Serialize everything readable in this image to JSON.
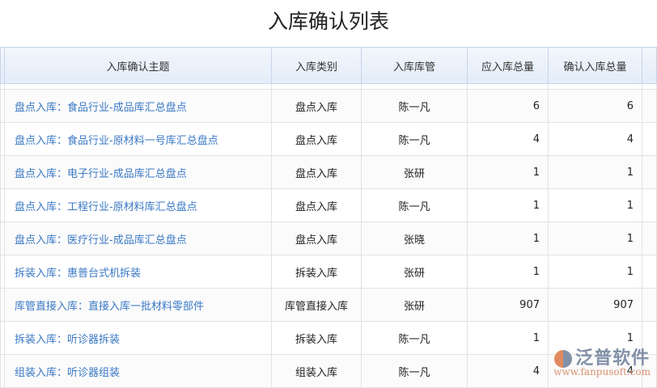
{
  "title": "入库确认列表",
  "headers": [
    "入库确认主题",
    "入库类别",
    "入库库管",
    "应入库总量",
    "确认入库总量"
  ],
  "rows": [
    [
      "盘点入库：食品行业-成品库汇总盘点",
      "盘点入库",
      "陈一凡",
      "6",
      "6"
    ],
    [
      "盘点入库：食品行业-原材料一号库汇总盘点",
      "盘点入库",
      "陈一凡",
      "4",
      "4"
    ],
    [
      "盘点入库：电子行业-成品库汇总盘点",
      "盘点入库",
      "张研",
      "1",
      "1"
    ],
    [
      "盘点入库：工程行业-原材料库汇总盘点",
      "盘点入库",
      "陈一凡",
      "1",
      "1"
    ],
    [
      "盘点入库：医疗行业-成品库汇总盘点",
      "盘点入库",
      "张晓",
      "1",
      "1"
    ],
    [
      "拆装入库：惠普台式机拆装",
      "拆装入库",
      "张研",
      "1",
      "1"
    ],
    [
      "库管直接入库：直接入库一批材料零部件",
      "库管直接入库",
      "张研",
      "907",
      "907"
    ],
    [
      "拆装入库：听诊器拆装",
      "拆装入库",
      "陈一凡",
      "1",
      "1"
    ],
    [
      "组装入库：听诊器组装",
      "组装入库",
      "陈一凡",
      "4",
      "4"
    ]
  ],
  "watermark": {
    "name": "泛普软件",
    "url": "www.fanpusoft.com"
  }
}
